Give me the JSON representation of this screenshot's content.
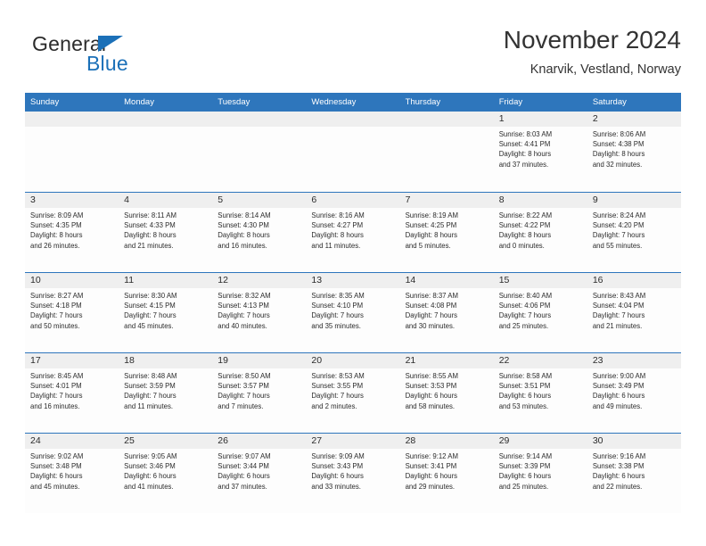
{
  "brand": {
    "word_one": "General",
    "word_two": "Blue",
    "accent_color": "#1b70b8",
    "triangle_icon": "triangle-icon"
  },
  "header": {
    "title": "November 2024",
    "location": "Knarvik, Vestland, Norway"
  },
  "theme": {
    "header_blue": "#2e76bc",
    "day_band_gray": "#efefef",
    "text_color": "#2b2b2b",
    "cell_background": "#fdfdfd"
  },
  "weekdays": [
    "Sunday",
    "Monday",
    "Tuesday",
    "Wednesday",
    "Thursday",
    "Friday",
    "Saturday"
  ],
  "weeks": [
    [
      {
        "day": "",
        "empty": true
      },
      {
        "day": "",
        "empty": true
      },
      {
        "day": "",
        "empty": true
      },
      {
        "day": "",
        "empty": true
      },
      {
        "day": "",
        "empty": true
      },
      {
        "day": "1",
        "sunrise": "Sunrise: 8:03 AM",
        "sunset": "Sunset: 4:41 PM",
        "daylight_1": "Daylight: 8 hours",
        "daylight_2": "and 37 minutes."
      },
      {
        "day": "2",
        "sunrise": "Sunrise: 8:06 AM",
        "sunset": "Sunset: 4:38 PM",
        "daylight_1": "Daylight: 8 hours",
        "daylight_2": "and 32 minutes."
      }
    ],
    [
      {
        "day": "3",
        "sunrise": "Sunrise: 8:09 AM",
        "sunset": "Sunset: 4:35 PM",
        "daylight_1": "Daylight: 8 hours",
        "daylight_2": "and 26 minutes."
      },
      {
        "day": "4",
        "sunrise": "Sunrise: 8:11 AM",
        "sunset": "Sunset: 4:33 PM",
        "daylight_1": "Daylight: 8 hours",
        "daylight_2": "and 21 minutes."
      },
      {
        "day": "5",
        "sunrise": "Sunrise: 8:14 AM",
        "sunset": "Sunset: 4:30 PM",
        "daylight_1": "Daylight: 8 hours",
        "daylight_2": "and 16 minutes."
      },
      {
        "day": "6",
        "sunrise": "Sunrise: 8:16 AM",
        "sunset": "Sunset: 4:27 PM",
        "daylight_1": "Daylight: 8 hours",
        "daylight_2": "and 11 minutes."
      },
      {
        "day": "7",
        "sunrise": "Sunrise: 8:19 AM",
        "sunset": "Sunset: 4:25 PM",
        "daylight_1": "Daylight: 8 hours",
        "daylight_2": "and 5 minutes."
      },
      {
        "day": "8",
        "sunrise": "Sunrise: 8:22 AM",
        "sunset": "Sunset: 4:22 PM",
        "daylight_1": "Daylight: 8 hours",
        "daylight_2": "and 0 minutes."
      },
      {
        "day": "9",
        "sunrise": "Sunrise: 8:24 AM",
        "sunset": "Sunset: 4:20 PM",
        "daylight_1": "Daylight: 7 hours",
        "daylight_2": "and 55 minutes."
      }
    ],
    [
      {
        "day": "10",
        "sunrise": "Sunrise: 8:27 AM",
        "sunset": "Sunset: 4:18 PM",
        "daylight_1": "Daylight: 7 hours",
        "daylight_2": "and 50 minutes."
      },
      {
        "day": "11",
        "sunrise": "Sunrise: 8:30 AM",
        "sunset": "Sunset: 4:15 PM",
        "daylight_1": "Daylight: 7 hours",
        "daylight_2": "and 45 minutes."
      },
      {
        "day": "12",
        "sunrise": "Sunrise: 8:32 AM",
        "sunset": "Sunset: 4:13 PM",
        "daylight_1": "Daylight: 7 hours",
        "daylight_2": "and 40 minutes."
      },
      {
        "day": "13",
        "sunrise": "Sunrise: 8:35 AM",
        "sunset": "Sunset: 4:10 PM",
        "daylight_1": "Daylight: 7 hours",
        "daylight_2": "and 35 minutes."
      },
      {
        "day": "14",
        "sunrise": "Sunrise: 8:37 AM",
        "sunset": "Sunset: 4:08 PM",
        "daylight_1": "Daylight: 7 hours",
        "daylight_2": "and 30 minutes."
      },
      {
        "day": "15",
        "sunrise": "Sunrise: 8:40 AM",
        "sunset": "Sunset: 4:06 PM",
        "daylight_1": "Daylight: 7 hours",
        "daylight_2": "and 25 minutes."
      },
      {
        "day": "16",
        "sunrise": "Sunrise: 8:43 AM",
        "sunset": "Sunset: 4:04 PM",
        "daylight_1": "Daylight: 7 hours",
        "daylight_2": "and 21 minutes."
      }
    ],
    [
      {
        "day": "17",
        "sunrise": "Sunrise: 8:45 AM",
        "sunset": "Sunset: 4:01 PM",
        "daylight_1": "Daylight: 7 hours",
        "daylight_2": "and 16 minutes."
      },
      {
        "day": "18",
        "sunrise": "Sunrise: 8:48 AM",
        "sunset": "Sunset: 3:59 PM",
        "daylight_1": "Daylight: 7 hours",
        "daylight_2": "and 11 minutes."
      },
      {
        "day": "19",
        "sunrise": "Sunrise: 8:50 AM",
        "sunset": "Sunset: 3:57 PM",
        "daylight_1": "Daylight: 7 hours",
        "daylight_2": "and 7 minutes."
      },
      {
        "day": "20",
        "sunrise": "Sunrise: 8:53 AM",
        "sunset": "Sunset: 3:55 PM",
        "daylight_1": "Daylight: 7 hours",
        "daylight_2": "and 2 minutes."
      },
      {
        "day": "21",
        "sunrise": "Sunrise: 8:55 AM",
        "sunset": "Sunset: 3:53 PM",
        "daylight_1": "Daylight: 6 hours",
        "daylight_2": "and 58 minutes."
      },
      {
        "day": "22",
        "sunrise": "Sunrise: 8:58 AM",
        "sunset": "Sunset: 3:51 PM",
        "daylight_1": "Daylight: 6 hours",
        "daylight_2": "and 53 minutes."
      },
      {
        "day": "23",
        "sunrise": "Sunrise: 9:00 AM",
        "sunset": "Sunset: 3:49 PM",
        "daylight_1": "Daylight: 6 hours",
        "daylight_2": "and 49 minutes."
      }
    ],
    [
      {
        "day": "24",
        "sunrise": "Sunrise: 9:02 AM",
        "sunset": "Sunset: 3:48 PM",
        "daylight_1": "Daylight: 6 hours",
        "daylight_2": "and 45 minutes."
      },
      {
        "day": "25",
        "sunrise": "Sunrise: 9:05 AM",
        "sunset": "Sunset: 3:46 PM",
        "daylight_1": "Daylight: 6 hours",
        "daylight_2": "and 41 minutes."
      },
      {
        "day": "26",
        "sunrise": "Sunrise: 9:07 AM",
        "sunset": "Sunset: 3:44 PM",
        "daylight_1": "Daylight: 6 hours",
        "daylight_2": "and 37 minutes."
      },
      {
        "day": "27",
        "sunrise": "Sunrise: 9:09 AM",
        "sunset": "Sunset: 3:43 PM",
        "daylight_1": "Daylight: 6 hours",
        "daylight_2": "and 33 minutes."
      },
      {
        "day": "28",
        "sunrise": "Sunrise: 9:12 AM",
        "sunset": "Sunset: 3:41 PM",
        "daylight_1": "Daylight: 6 hours",
        "daylight_2": "and 29 minutes."
      },
      {
        "day": "29",
        "sunrise": "Sunrise: 9:14 AM",
        "sunset": "Sunset: 3:39 PM",
        "daylight_1": "Daylight: 6 hours",
        "daylight_2": "and 25 minutes."
      },
      {
        "day": "30",
        "sunrise": "Sunrise: 9:16 AM",
        "sunset": "Sunset: 3:38 PM",
        "daylight_1": "Daylight: 6 hours",
        "daylight_2": "and 22 minutes."
      }
    ]
  ]
}
